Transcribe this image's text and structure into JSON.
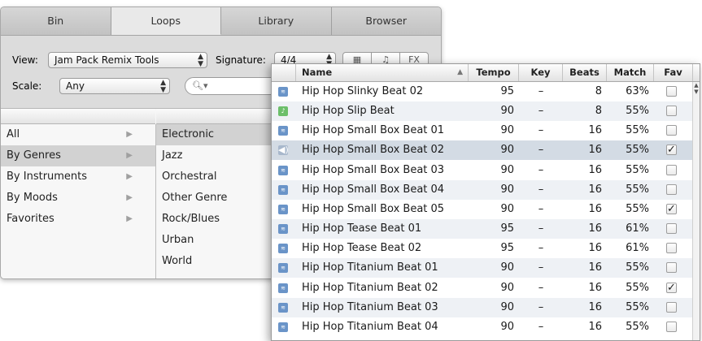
{
  "tabs": [
    "Bin",
    "Loops",
    "Library",
    "Browser"
  ],
  "active_tab": "Loops",
  "view": {
    "label": "View:",
    "value": "Jam Pack Remix Tools"
  },
  "signature": {
    "label": "Signature:",
    "value": "4/4"
  },
  "scale": {
    "label": "Scale:",
    "value": "Any"
  },
  "search": {
    "icon": "search-icon",
    "value": ""
  },
  "view_buttons": [
    "grid-icon",
    "note-icon",
    "fx-icon"
  ],
  "categories": [
    {
      "label": "All",
      "selected": false
    },
    {
      "label": "By Genres",
      "selected": true
    },
    {
      "label": "By Instruments",
      "selected": false
    },
    {
      "label": "By Moods",
      "selected": false
    },
    {
      "label": "Favorites",
      "selected": false
    }
  ],
  "genres": [
    {
      "label": "Electronic",
      "selected": true
    },
    {
      "label": "Jazz",
      "selected": false
    },
    {
      "label": "Orchestral",
      "selected": false
    },
    {
      "label": "Other Genre",
      "selected": false
    },
    {
      "label": "Rock/Blues",
      "selected": false
    },
    {
      "label": "Urban",
      "selected": false
    },
    {
      "label": "World",
      "selected": false
    }
  ],
  "table": {
    "columns": [
      "Name",
      "Tempo",
      "Key",
      "Beats",
      "Match",
      "Fav"
    ],
    "rows": [
      {
        "name": "Hip Hop Slinky Beat 02",
        "tempo": "95",
        "key": "–",
        "beats": "8",
        "match": "63%",
        "fav": false,
        "icon": "waveform-icon"
      },
      {
        "name": "Hip Hop Slip Beat",
        "tempo": "90",
        "key": "–",
        "beats": "8",
        "match": "55%",
        "fav": false,
        "icon": "midi-note-icon"
      },
      {
        "name": "Hip Hop Small Box Beat 01",
        "tempo": "90",
        "key": "–",
        "beats": "16",
        "match": "55%",
        "fav": false,
        "icon": "waveform-icon"
      },
      {
        "name": "Hip Hop Small Box Beat 02",
        "tempo": "90",
        "key": "–",
        "beats": "16",
        "match": "55%",
        "fav": true,
        "icon": "speaker-icon",
        "selected": true
      },
      {
        "name": "Hip Hop Small Box Beat 03",
        "tempo": "90",
        "key": "–",
        "beats": "16",
        "match": "55%",
        "fav": false,
        "icon": "waveform-icon"
      },
      {
        "name": "Hip Hop Small Box Beat 04",
        "tempo": "90",
        "key": "–",
        "beats": "16",
        "match": "55%",
        "fav": false,
        "icon": "waveform-icon"
      },
      {
        "name": "Hip Hop Small Box Beat 05",
        "tempo": "90",
        "key": "–",
        "beats": "16",
        "match": "55%",
        "fav": true,
        "icon": "waveform-icon"
      },
      {
        "name": "Hip Hop Tease Beat 01",
        "tempo": "95",
        "key": "–",
        "beats": "16",
        "match": "61%",
        "fav": false,
        "icon": "waveform-icon"
      },
      {
        "name": "Hip Hop Tease Beat 02",
        "tempo": "95",
        "key": "–",
        "beats": "16",
        "match": "61%",
        "fav": false,
        "icon": "waveform-icon"
      },
      {
        "name": "Hip Hop Titanium Beat 01",
        "tempo": "90",
        "key": "–",
        "beats": "16",
        "match": "55%",
        "fav": false,
        "icon": "waveform-icon"
      },
      {
        "name": "Hip Hop Titanium Beat 02",
        "tempo": "90",
        "key": "–",
        "beats": "16",
        "match": "55%",
        "fav": true,
        "icon": "waveform-icon"
      },
      {
        "name": "Hip Hop Titanium Beat 03",
        "tempo": "90",
        "key": "–",
        "beats": "16",
        "match": "55%",
        "fav": false,
        "icon": "waveform-icon"
      },
      {
        "name": "Hip Hop Titanium Beat 04",
        "tempo": "90",
        "key": "–",
        "beats": "16",
        "match": "55%",
        "fav": false,
        "icon": "waveform-icon"
      }
    ]
  }
}
